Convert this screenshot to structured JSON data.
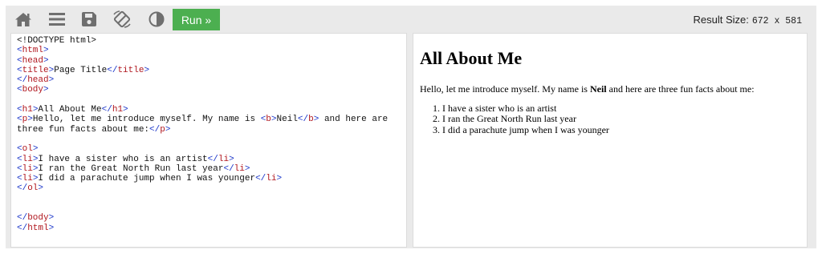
{
  "toolbar": {
    "icons": [
      "home-icon",
      "menu-icon",
      "save-icon",
      "rotate-icon",
      "contrast-icon"
    ],
    "run_label": "Run »",
    "result_size_label": "Result Size:",
    "result_size_value": "672 x 581"
  },
  "code": {
    "lines": [
      [
        {
          "t": "<!DOCTYPE html>",
          "c": "txt"
        }
      ],
      [
        {
          "t": "<",
          "c": "br"
        },
        {
          "t": "html",
          "c": "tag"
        },
        {
          "t": ">",
          "c": "br"
        }
      ],
      [
        {
          "t": "<",
          "c": "br"
        },
        {
          "t": "head",
          "c": "tag"
        },
        {
          "t": ">",
          "c": "br"
        }
      ],
      [
        {
          "t": "<",
          "c": "br"
        },
        {
          "t": "title",
          "c": "tag"
        },
        {
          "t": ">",
          "c": "br"
        },
        {
          "t": "Page Title",
          "c": "txt"
        },
        {
          "t": "</",
          "c": "br"
        },
        {
          "t": "title",
          "c": "tag"
        },
        {
          "t": ">",
          "c": "br"
        }
      ],
      [
        {
          "t": "</",
          "c": "br"
        },
        {
          "t": "head",
          "c": "tag"
        },
        {
          "t": ">",
          "c": "br"
        }
      ],
      [
        {
          "t": "<",
          "c": "br"
        },
        {
          "t": "body",
          "c": "tag"
        },
        {
          "t": ">",
          "c": "br"
        }
      ],
      [],
      [
        {
          "t": "<",
          "c": "br"
        },
        {
          "t": "h1",
          "c": "tag"
        },
        {
          "t": ">",
          "c": "br"
        },
        {
          "t": "All About Me",
          "c": "txt"
        },
        {
          "t": "</",
          "c": "br"
        },
        {
          "t": "h1",
          "c": "tag"
        },
        {
          "t": ">",
          "c": "br"
        }
      ],
      [
        {
          "t": "<",
          "c": "br"
        },
        {
          "t": "p",
          "c": "tag"
        },
        {
          "t": ">",
          "c": "br"
        },
        {
          "t": "Hello, let me introduce myself. My name is ",
          "c": "txt"
        },
        {
          "t": "<",
          "c": "br"
        },
        {
          "t": "b",
          "c": "tag"
        },
        {
          "t": ">",
          "c": "br"
        },
        {
          "t": "Neil",
          "c": "txt"
        },
        {
          "t": "</",
          "c": "br"
        },
        {
          "t": "b",
          "c": "tag"
        },
        {
          "t": ">",
          "c": "br"
        },
        {
          "t": " and here are",
          "c": "txt"
        }
      ],
      [
        {
          "t": "three fun facts about me:",
          "c": "txt"
        },
        {
          "t": "</",
          "c": "br"
        },
        {
          "t": "p",
          "c": "tag"
        },
        {
          "t": ">",
          "c": "br"
        }
      ],
      [],
      [
        {
          "t": "<",
          "c": "br"
        },
        {
          "t": "ol",
          "c": "tag"
        },
        {
          "t": ">",
          "c": "br"
        }
      ],
      [
        {
          "t": "<",
          "c": "br"
        },
        {
          "t": "li",
          "c": "tag"
        },
        {
          "t": ">",
          "c": "br"
        },
        {
          "t": "I have a sister who is an artist",
          "c": "txt"
        },
        {
          "t": "</",
          "c": "br"
        },
        {
          "t": "li",
          "c": "tag"
        },
        {
          "t": ">",
          "c": "br"
        }
      ],
      [
        {
          "t": "<",
          "c": "br"
        },
        {
          "t": "li",
          "c": "tag"
        },
        {
          "t": ">",
          "c": "br"
        },
        {
          "t": "I ran the Great North Run last year",
          "c": "txt"
        },
        {
          "t": "</",
          "c": "br"
        },
        {
          "t": "li",
          "c": "tag"
        },
        {
          "t": ">",
          "c": "br"
        }
      ],
      [
        {
          "t": "<",
          "c": "br"
        },
        {
          "t": "li",
          "c": "tag"
        },
        {
          "t": ">",
          "c": "br"
        },
        {
          "t": "I did a parachute jump when I was younger",
          "c": "txt"
        },
        {
          "t": "</",
          "c": "br"
        },
        {
          "t": "li",
          "c": "tag"
        },
        {
          "t": ">",
          "c": "br"
        }
      ],
      [
        {
          "t": "</",
          "c": "br"
        },
        {
          "t": "ol",
          "c": "tag"
        },
        {
          "t": ">",
          "c": "br"
        }
      ],
      [],
      [],
      [
        {
          "t": "</",
          "c": "br"
        },
        {
          "t": "body",
          "c": "tag"
        },
        {
          "t": ">",
          "c": "br"
        }
      ],
      [
        {
          "t": "</",
          "c": "br"
        },
        {
          "t": "html",
          "c": "tag"
        },
        {
          "t": ">",
          "c": "br"
        }
      ]
    ]
  },
  "result": {
    "heading": "All About Me",
    "intro_before": "Hello, let me introduce myself. My name is ",
    "intro_bold": "Neil",
    "intro_after": " and here are three fun facts about me:",
    "facts": [
      "I have a sister who is an artist",
      "I ran the Great North Run last year",
      "I did a parachute jump when I was younger"
    ]
  },
  "colors": {
    "run_button": "#4caf50",
    "tag_name": "#b0171f",
    "bracket": "#1a35c9",
    "toolbar_bg": "#eaeaea"
  }
}
